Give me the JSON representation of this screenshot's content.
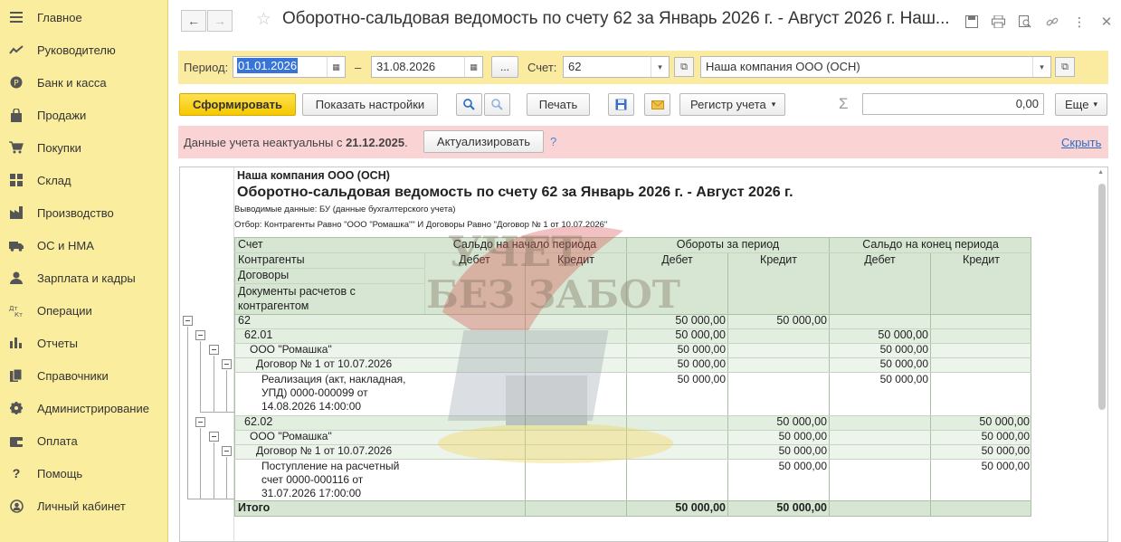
{
  "sidebar": {
    "items": [
      {
        "label": "Главное",
        "icon": "menu-icon"
      },
      {
        "label": "Руководителю",
        "icon": "trend-icon"
      },
      {
        "label": "Банк и касса",
        "icon": "coin-icon"
      },
      {
        "label": "Продажи",
        "icon": "bag-icon"
      },
      {
        "label": "Покупки",
        "icon": "cart-icon"
      },
      {
        "label": "Склад",
        "icon": "warehouse-icon"
      },
      {
        "label": "Производство",
        "icon": "factory-icon"
      },
      {
        "label": "ОС и НМА",
        "icon": "truck-icon"
      },
      {
        "label": "Зарплата и кадры",
        "icon": "person-icon"
      },
      {
        "label": "Операции",
        "icon": "dt-kt-icon"
      },
      {
        "label": "Отчеты",
        "icon": "bar-chart-icon"
      },
      {
        "label": "Справочники",
        "icon": "books-icon"
      },
      {
        "label": "Администрирование",
        "icon": "gear-icon"
      },
      {
        "label": "Оплата",
        "icon": "wallet-icon"
      },
      {
        "label": "Помощь",
        "icon": "question-icon"
      },
      {
        "label": "Личный кабинет",
        "icon": "account-icon"
      }
    ]
  },
  "header": {
    "title": "Оборотно-сальдовая ведомость по счету 62 за Январь 2026 г. - Август 2026 г. Наш..."
  },
  "period": {
    "label": "Период:",
    "from": "01.01.2026",
    "dash": "–",
    "to": "31.08.2026",
    "dots": "...",
    "account_label": "Счет:",
    "account": "62",
    "company": "Наша компания ООО (ОСН)"
  },
  "toolbar": {
    "generate": "Сформировать",
    "show_settings": "Показать настройки",
    "print": "Печать",
    "register": "Регистр учета",
    "sum_symbol": "Σ",
    "sum_value": "0,00",
    "more": "Еще"
  },
  "alert": {
    "text": "Данные учета неактуальны с",
    "date": "21.12.2025",
    "dot": ".",
    "update_button": "Актуализировать",
    "help": "?",
    "hide_link": "Скрыть"
  },
  "report": {
    "company": "Наша компания ООО (ОСН)",
    "title": "Оборотно-сальдовая ведомость по счету 62 за Январь 2026 г. - Август 2026 г.",
    "output_data": "Выводимые данные: БУ (данные бухгалтерского учета)",
    "filter": "Отбор: Контрагенты Равно \"ООО \"Ромашка\"\" И Договоры Равно \"Договор № 1 от 10.07.2026\"",
    "headers": {
      "account": "Счет",
      "counterparties": "Контрагенты",
      "contracts": "Договоры",
      "documents": "Документы расчетов с контрагентом",
      "opening": "Сальдо на начало периода",
      "turnover": "Обороты за период",
      "closing": "Сальдо на конец периода",
      "debit": "Дебет",
      "credit": "Кредит"
    },
    "rows": [
      {
        "name": "62",
        "ob_dt": "50 000,00",
        "ob_kt": "50 000,00",
        "end_dt": "",
        "end_kt": ""
      },
      {
        "name": "62.01",
        "ob_dt": "50 000,00",
        "ob_kt": "",
        "end_dt": "50 000,00",
        "end_kt": ""
      },
      {
        "name": "ООО \"Ромашка\"",
        "ob_dt": "50 000,00",
        "ob_kt": "",
        "end_dt": "50 000,00",
        "end_kt": ""
      },
      {
        "name": "Договор № 1 от 10.07.2026",
        "ob_dt": "50 000,00",
        "ob_kt": "",
        "end_dt": "50 000,00",
        "end_kt": ""
      },
      {
        "name_lines": [
          "Реализация (акт, накладная,",
          "УПД) 0000-000099 от",
          "14.08.2026 14:00:00"
        ],
        "ob_dt": "50 000,00",
        "ob_kt": "",
        "end_dt": "50 000,00",
        "end_kt": ""
      },
      {
        "name": "62.02",
        "ob_dt": "",
        "ob_kt": "50 000,00",
        "end_dt": "",
        "end_kt": "50 000,00"
      },
      {
        "name": "ООО \"Ромашка\"",
        "ob_dt": "",
        "ob_kt": "50 000,00",
        "end_dt": "",
        "end_kt": "50 000,00"
      },
      {
        "name": "Договор № 1 от 10.07.2026",
        "ob_dt": "",
        "ob_kt": "50 000,00",
        "end_dt": "",
        "end_kt": "50 000,00"
      },
      {
        "name_lines": [
          "Поступление на расчетный",
          "счет 0000-000116 от",
          "31.07.2026 17:00:00"
        ],
        "ob_dt": "",
        "ob_kt": "50 000,00",
        "end_dt": "",
        "end_kt": "50 000,00"
      }
    ],
    "total": {
      "name": "Итого",
      "ob_dt": "50 000,00",
      "ob_kt": "50 000,00"
    }
  },
  "watermark": {
    "line1": "УЧЕТ",
    "line2": "БЕЗ ЗАБОТ"
  }
}
